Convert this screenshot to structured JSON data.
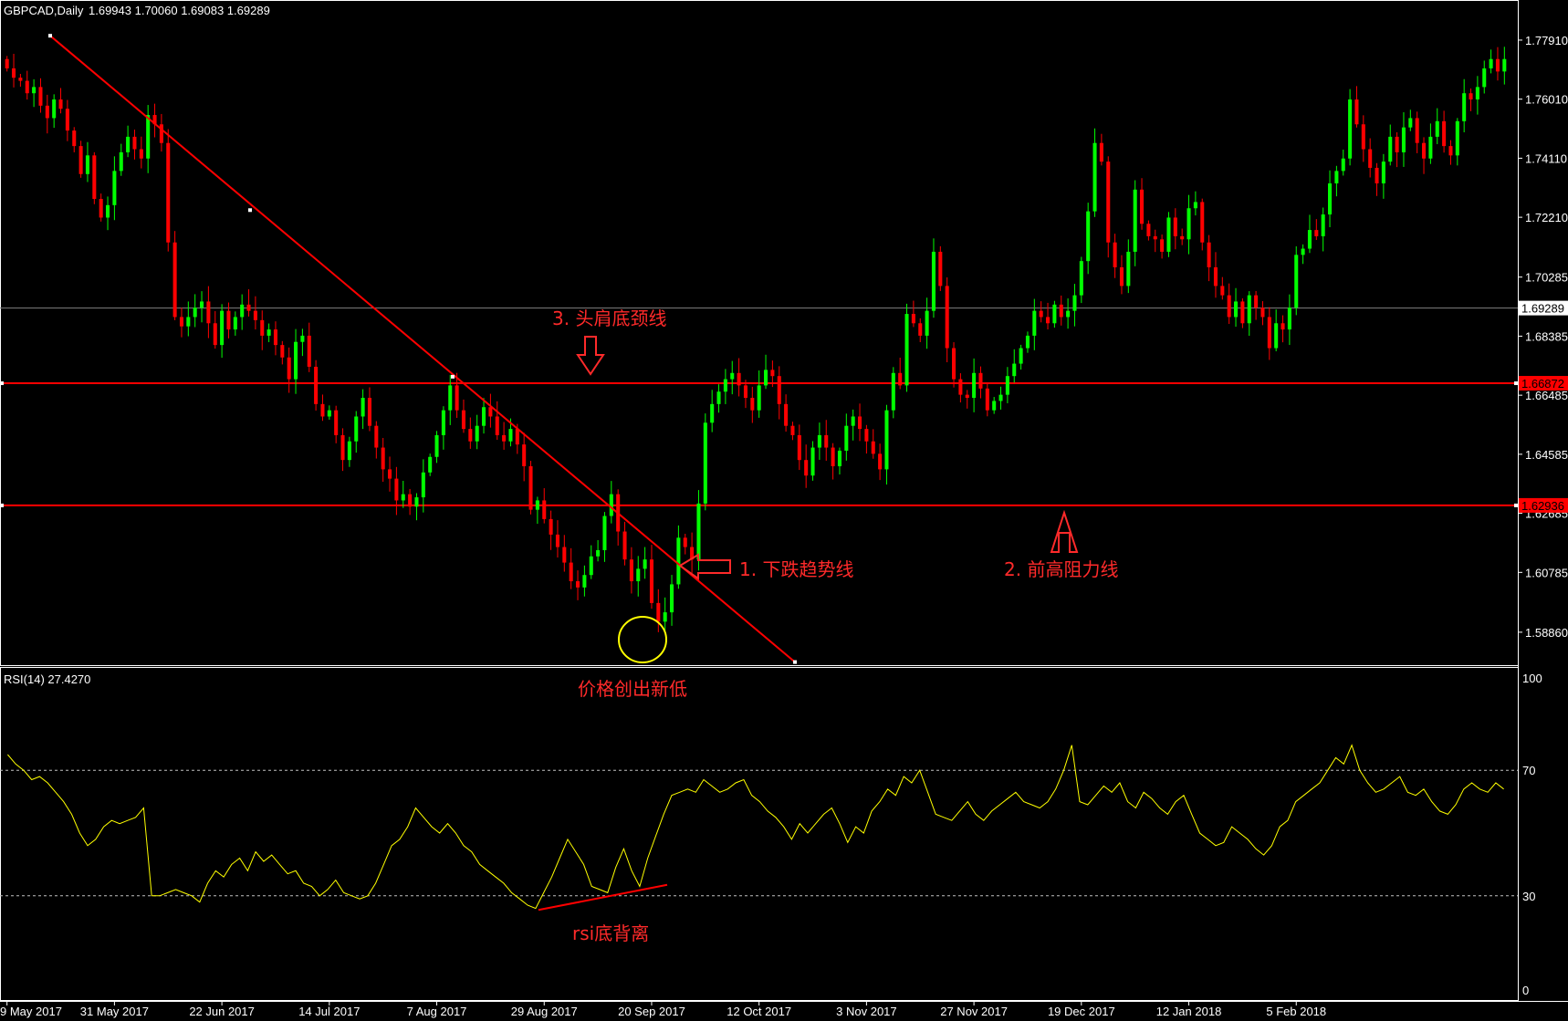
{
  "header": {
    "symbol": "GBPCAD,Daily",
    "ohlc": "1.69943 1.70060 1.69083 1.69289"
  },
  "rsi_header": "RSI(14) 27.4270",
  "colors": {
    "bull": "#00ff00",
    "bear": "#ff0000",
    "line": "#ff0000",
    "rsi": "#ffff00",
    "current": "#808080",
    "circle": "#ffff00"
  },
  "annotations": {
    "neckline": "3. 头肩底颈线",
    "downtrend": "1. 下跌趋势线",
    "resistance": "2. 前高阻力线",
    "new_low": "价格创出新低",
    "divergence": "rsi底背离"
  },
  "chart_data": [
    {
      "type": "candlestick",
      "title": "GBPCAD,Daily",
      "y_ticks": [
        "1.77910",
        "1.76010",
        "1.74110",
        "1.72210",
        "1.70285",
        "1.68385",
        "1.66485",
        "1.64585",
        "1.62685",
        "1.60785",
        "1.58860"
      ],
      "ylim": [
        1.578,
        1.792
      ],
      "x_ticks": [
        "9 May 2017",
        "31 May 2017",
        "22 Jun 2017",
        "14 Jul 2017",
        "7 Aug 2017",
        "29 Aug 2017",
        "20 Sep 2017",
        "12 Oct 2017",
        "3 Nov 2017",
        "27 Nov 2017",
        "19 Dec 2017",
        "12 Jan 2018",
        "5 Feb 2018"
      ],
      "current_price": "1.69289",
      "horizontal_lines": [
        {
          "value": 1.6687,
          "label": "1.66872"
        },
        {
          "value": 1.6294,
          "label": "1.62936"
        }
      ],
      "trendline": {
        "from": {
          "x": "11 May 2017",
          "y": 1.7805
        },
        "to": {
          "x": "2 Oct 2017",
          "y": 1.579
        }
      },
      "closes": [
        1.77,
        1.767,
        1.766,
        1.762,
        1.764,
        1.758,
        1.754,
        1.76,
        1.757,
        1.75,
        1.745,
        1.736,
        1.742,
        1.728,
        1.722,
        1.726,
        1.737,
        1.743,
        1.748,
        1.744,
        1.741,
        1.755,
        1.752,
        1.746,
        1.714,
        1.69,
        1.687,
        1.69,
        1.693,
        1.695,
        1.688,
        1.681,
        1.692,
        1.686,
        1.69,
        1.694,
        1.692,
        1.689,
        1.684,
        1.686,
        1.681,
        1.677,
        1.67,
        1.682,
        1.684,
        1.674,
        1.662,
        1.658,
        1.66,
        1.652,
        1.644,
        1.65,
        1.658,
        1.664,
        1.655,
        1.648,
        1.641,
        1.638,
        1.631,
        1.633,
        1.629,
        1.632,
        1.64,
        1.645,
        1.652,
        1.66,
        1.668,
        1.66,
        1.654,
        1.65,
        1.655,
        1.661,
        1.658,
        1.652,
        1.65,
        1.654,
        1.649,
        1.642,
        1.628,
        1.631,
        1.625,
        1.62,
        1.616,
        1.611,
        1.605,
        1.603,
        1.607,
        1.613,
        1.615,
        1.626,
        1.633,
        1.621,
        1.612,
        1.605,
        1.609,
        1.612,
        1.598,
        1.592,
        1.595,
        1.604,
        1.619,
        1.616,
        1.612,
        1.63,
        1.656,
        1.662,
        1.666,
        1.67,
        1.672,
        1.668,
        1.664,
        1.66,
        1.668,
        1.673,
        1.671,
        1.662,
        1.655,
        1.652,
        1.644,
        1.639,
        1.648,
        1.652,
        1.648,
        1.642,
        1.647,
        1.655,
        1.658,
        1.654,
        1.65,
        1.646,
        1.641,
        1.66,
        1.672,
        1.668,
        1.691,
        1.688,
        1.684,
        1.692,
        1.711,
        1.7,
        1.68,
        1.67,
        1.665,
        1.664,
        1.672,
        1.667,
        1.66,
        1.663,
        1.665,
        1.671,
        1.675,
        1.68,
        1.684,
        1.692,
        1.69,
        1.688,
        1.694,
        1.69,
        1.692,
        1.697,
        1.708,
        1.724,
        1.746,
        1.74,
        1.714,
        1.706,
        1.7,
        1.711,
        1.731,
        1.72,
        1.716,
        1.715,
        1.711,
        1.722,
        1.716,
        1.715,
        1.725,
        1.727,
        1.714,
        1.706,
        1.7,
        1.697,
        1.69,
        1.695,
        1.688,
        1.697,
        1.693,
        1.69,
        1.68,
        1.688,
        1.686,
        1.693,
        1.71,
        1.712,
        1.718,
        1.716,
        1.723,
        1.733,
        1.737,
        1.741,
        1.76,
        1.752,
        1.744,
        1.738,
        1.733,
        1.74,
        1.748,
        1.743,
        1.751,
        1.754,
        1.746,
        1.741,
        1.748,
        1.753,
        1.745,
        1.742,
        1.753,
        1.762,
        1.76,
        1.764,
        1.77,
        1.773,
        1.769,
        1.773
      ]
    },
    {
      "type": "line",
      "title": "RSI(14) 27.4270",
      "ylim": [
        0,
        100
      ],
      "y_ticks": [
        "100",
        "70",
        "30",
        "0"
      ],
      "levels": [
        70,
        30
      ],
      "divergence_line": {
        "from": {
          "x": "22 Aug 2017",
          "y": 25.5
        },
        "to": {
          "x": "12 Sep 2017",
          "y": 33.5
        }
      },
      "values": [
        75,
        72,
        70,
        67,
        68,
        66,
        63,
        60,
        56,
        50,
        46,
        48,
        52,
        54,
        53,
        54,
        55,
        58,
        30,
        30,
        31,
        32,
        31,
        30,
        28,
        34,
        38,
        36,
        40,
        42,
        38,
        44,
        41,
        43,
        40,
        37,
        38,
        34,
        33,
        30,
        32,
        35,
        31,
        30,
        29,
        30,
        34,
        40,
        46,
        48,
        52,
        58,
        55,
        52,
        50,
        53,
        50,
        46,
        44,
        40,
        38,
        36,
        34,
        31,
        29,
        27,
        26,
        31,
        36,
        42,
        48,
        44,
        40,
        33,
        32,
        31,
        39,
        45,
        38,
        33,
        42,
        49,
        56,
        62,
        63,
        64,
        63,
        67,
        65,
        63,
        64,
        66,
        67,
        62,
        60,
        57,
        55,
        52,
        48,
        53,
        50,
        53,
        56,
        58,
        53,
        47,
        52,
        50,
        57,
        60,
        64,
        62,
        68,
        66,
        70,
        63,
        56,
        55,
        54,
        57,
        60,
        56,
        54,
        57,
        59,
        61,
        63,
        60,
        59,
        58,
        60,
        64,
        70,
        78,
        60,
        59,
        62,
        65,
        63,
        66,
        60,
        58,
        63,
        61,
        58,
        56,
        60,
        62,
        56,
        50,
        48,
        46,
        47,
        52,
        50,
        48,
        45,
        43,
        46,
        52,
        54,
        60,
        62,
        64,
        66,
        70,
        74,
        72,
        78,
        70,
        66,
        63,
        64,
        66,
        68,
        63,
        62,
        64,
        60,
        57,
        56,
        59,
        64,
        66,
        64,
        63,
        66,
        64
      ]
    }
  ]
}
